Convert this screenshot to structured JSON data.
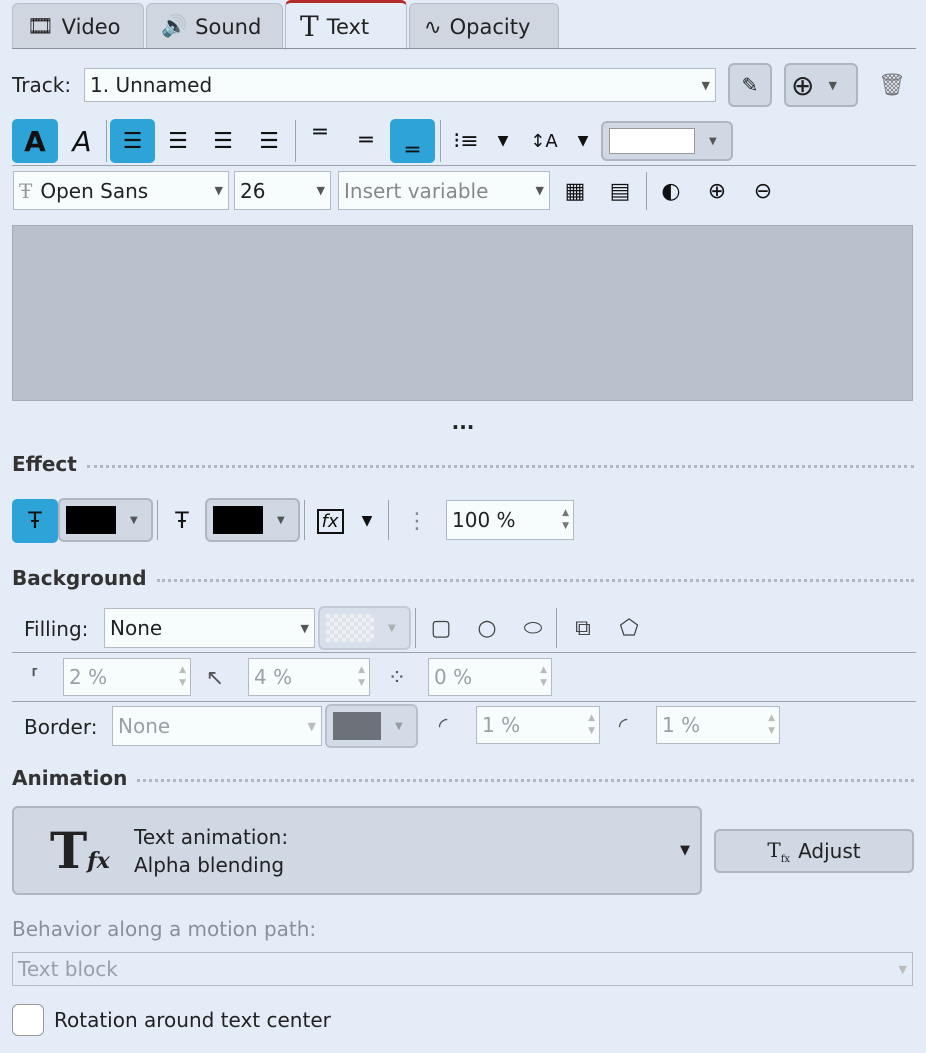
{
  "tabs": [
    {
      "label": "Video",
      "icon": "film-icon"
    },
    {
      "label": "Sound",
      "icon": "speaker-icon"
    },
    {
      "label": "Text",
      "icon": "text-icon",
      "active": true
    },
    {
      "label": "Opacity",
      "icon": "opacity-wave-icon"
    }
  ],
  "track": {
    "label": "Track:",
    "value": "1. Unnamed"
  },
  "font": {
    "family": "Open Sans",
    "size": "26",
    "variable_placeholder": "Insert variable"
  },
  "more": "...",
  "effect": {
    "title": "Effect",
    "fill_color": "#000000",
    "outline_color": "#000000",
    "opacity": "100 %"
  },
  "background": {
    "title": "Background",
    "filling_label": "Filling:",
    "filling_value": "None",
    "padding": "2 %",
    "corner": "4 %",
    "shadow": "0 %",
    "border_label": "Border:",
    "border_value": "None",
    "border_color": "#50535a",
    "border_width": "1 %",
    "border_radius": "1 %"
  },
  "animation": {
    "title": "Animation",
    "anim_label": "Text animation:",
    "anim_value": "Alpha blending",
    "adjust": "Adjust",
    "motion_label": "Behavior along a motion path:",
    "motion_value": "Text block",
    "rotation_label": "Rotation around text center",
    "rotation_checked": false
  },
  "colors": {
    "accent": "#2ea3d7",
    "active_tab": "#b52a2a",
    "preview": "#b9c2cc"
  }
}
